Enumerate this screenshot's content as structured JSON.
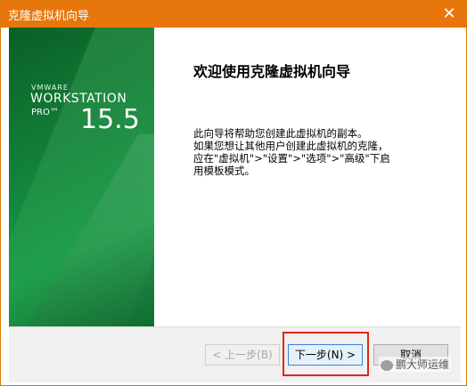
{
  "window": {
    "title": "克隆虚拟机向导",
    "close_glyph": "✕"
  },
  "banner": {
    "brand": "VMWARE",
    "product": "WORKSTATION",
    "edition": "PRO™",
    "version": "15.5"
  },
  "content": {
    "heading": "欢迎使用克隆虚拟机向导",
    "lines": [
      "此向导将帮助您创建此虚拟机的副本。",
      "如果您想让其他用户创建此虚拟机的克隆，",
      "应在\"虚拟机\">\"设置\">\"选项\">\"高级\"下启",
      "用模板模式。"
    ]
  },
  "buttons": {
    "back": "< 上一步(B)",
    "next": "下一步(N) >",
    "cancel": "取消"
  },
  "watermark": {
    "text": "鹏大师运维"
  }
}
